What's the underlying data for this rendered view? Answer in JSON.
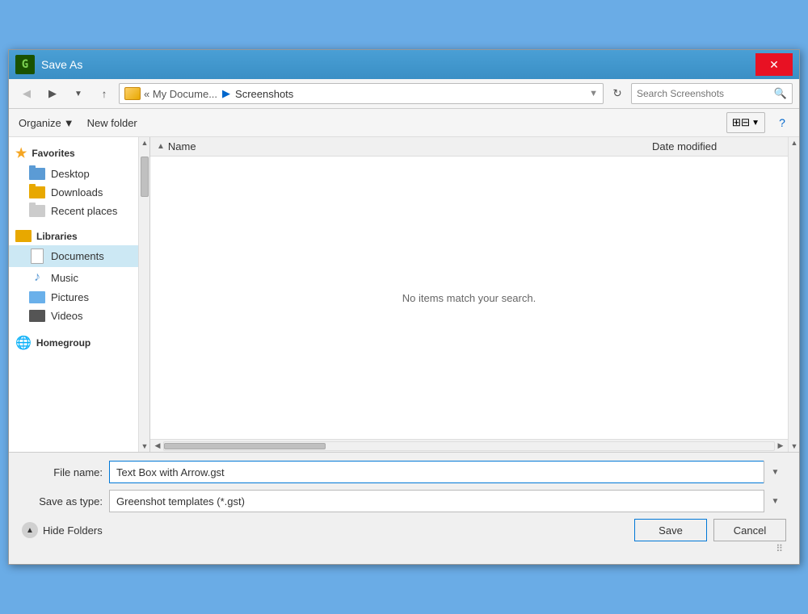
{
  "titlebar": {
    "title": "Save As",
    "app_icon": "🎮",
    "close_label": "✕"
  },
  "toolbar": {
    "back_tooltip": "Back",
    "forward_tooltip": "Forward",
    "dropdown_tooltip": "Recent locations",
    "up_tooltip": "Up one level",
    "address_icon": "📁",
    "address_text": "« My Docume... ▶ Screenshots",
    "address_breadcrumb": "« My Docume...",
    "address_separator": "▶",
    "address_folder": "Screenshots",
    "refresh_tooltip": "Refresh",
    "search_placeholder": "Search Screenshots",
    "search_icon": "🔍"
  },
  "toolbar2": {
    "organize_label": "Organize",
    "organize_arrow": "▼",
    "new_folder_label": "New folder",
    "view_icon": "⊞",
    "view_arrow": "▼",
    "help_label": "?"
  },
  "sidebar": {
    "favorites_header": "Favorites",
    "items_favorites": [
      {
        "label": "Desktop",
        "icon": "desktop"
      },
      {
        "label": "Downloads",
        "icon": "downloads"
      },
      {
        "label": "Recent places",
        "icon": "recent"
      }
    ],
    "libraries_header": "Libraries",
    "items_libraries": [
      {
        "label": "Documents",
        "icon": "documents",
        "selected": true
      },
      {
        "label": "Music",
        "icon": "music"
      },
      {
        "label": "Pictures",
        "icon": "pictures"
      },
      {
        "label": "Videos",
        "icon": "videos"
      }
    ],
    "homegroup_header": "Homegroup"
  },
  "file_list": {
    "col_name": "Name",
    "col_date": "Date modified",
    "empty_message": "No items match your search."
  },
  "form": {
    "file_name_label": "File name:",
    "file_name_value": "Text Box with Arrow.gst",
    "save_type_label": "Save as type:",
    "save_type_value": "Greenshot templates (*.gst)",
    "hide_folders_label": "Hide Folders",
    "save_label": "Save",
    "cancel_label": "Cancel"
  }
}
